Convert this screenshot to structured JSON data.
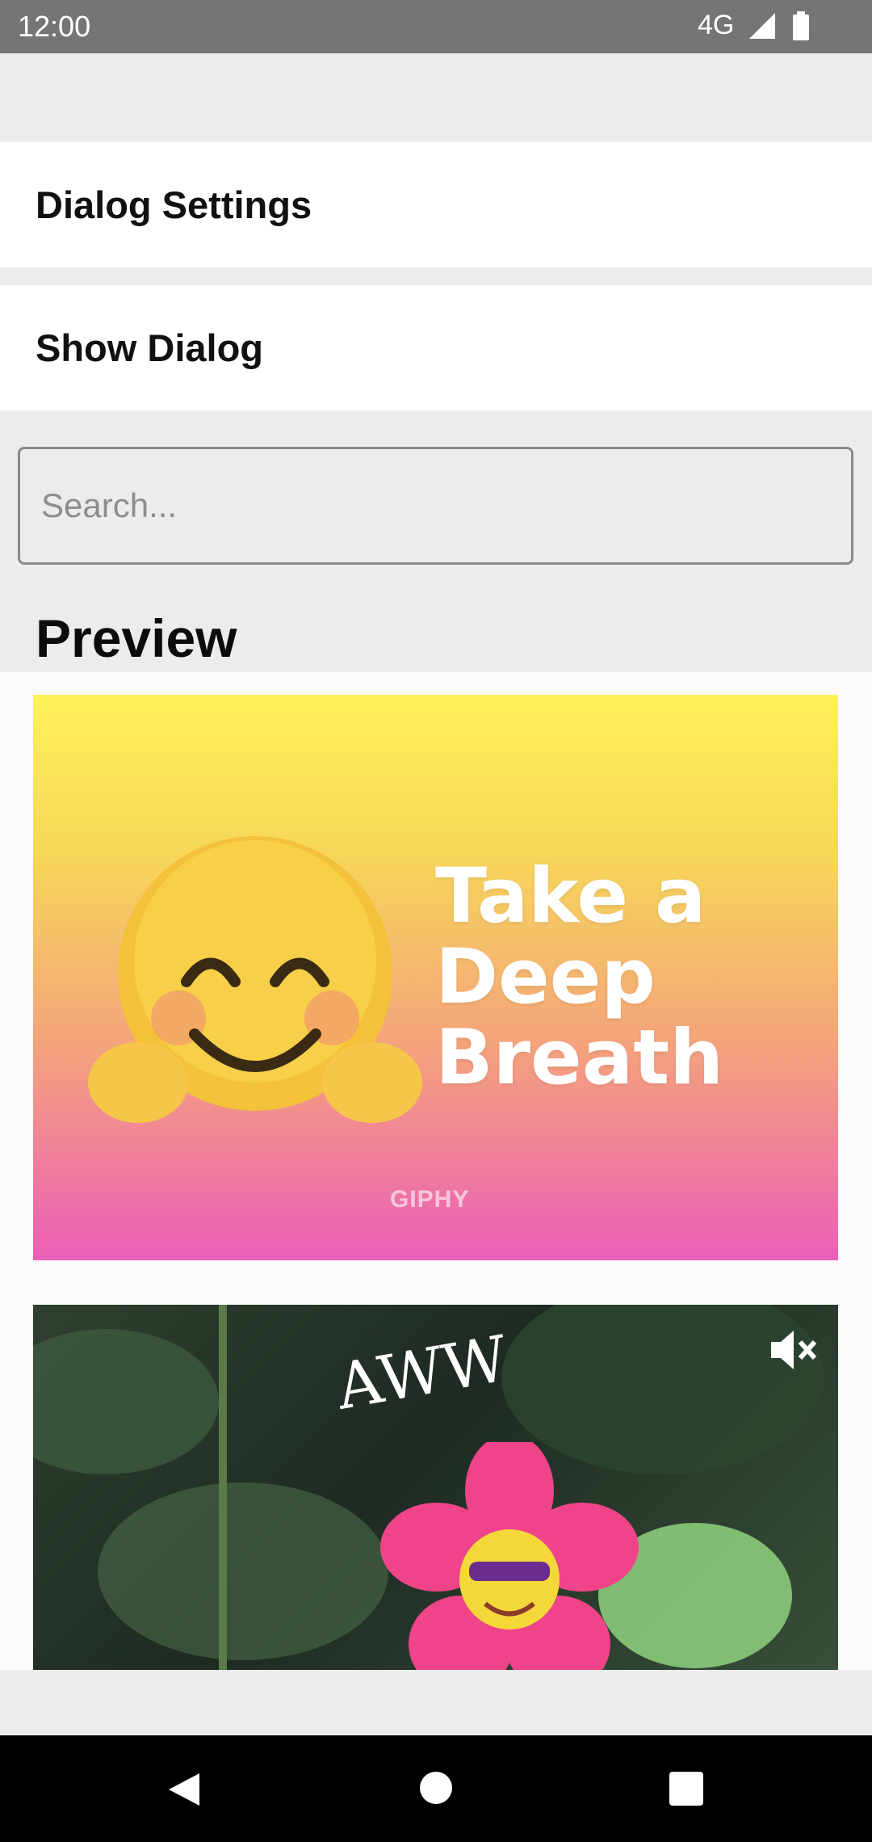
{
  "status_bar": {
    "time": "12:00",
    "network": "4G",
    "icons": [
      "signal-icon",
      "battery-icon"
    ]
  },
  "menu": {
    "dialog_settings": "Dialog Settings",
    "show_dialog": "Show Dialog"
  },
  "search": {
    "placeholder": "Search...",
    "value": ""
  },
  "preview": {
    "title": "Preview",
    "items": [
      {
        "caption_lines": [
          "Take a",
          "Deep",
          "Breath"
        ],
        "watermark": "GIPHY",
        "emoji": "🤗"
      },
      {
        "caption": "AWW",
        "emoji": "🌼",
        "mute_icon": "volume-mute-icon"
      }
    ]
  },
  "colors": {
    "status_bar": "#757575",
    "background": "#ececec",
    "nav_bar": "#000000"
  },
  "nav": {
    "icons": [
      "back-icon",
      "home-icon",
      "recents-icon"
    ]
  }
}
